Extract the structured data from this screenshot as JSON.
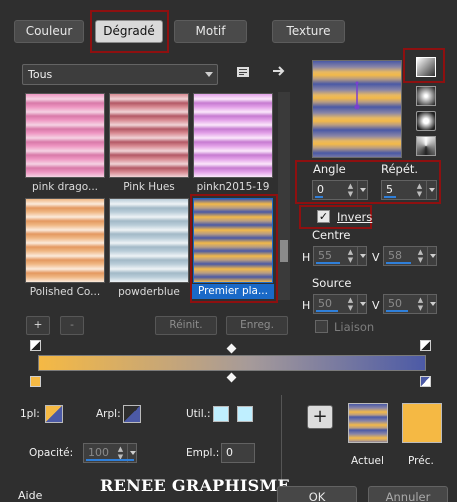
{
  "tabs": [
    {
      "label": "Couleur"
    },
    {
      "label": "Dégradé"
    },
    {
      "label": "Motif"
    },
    {
      "label": "Texture"
    }
  ],
  "category_dropdown": {
    "value": "Tous"
  },
  "gradients": [
    {
      "name": "pink drago...",
      "colors": [
        "#ee96c2",
        "#f5d2e3",
        "#d87aa9"
      ]
    },
    {
      "name": "Pink Hues",
      "colors": [
        "#d88a92",
        "#f0d3d6",
        "#b35966"
      ]
    },
    {
      "name": "pinkn2015-19",
      "colors": [
        "#e3a1e8",
        "#fbe7fb",
        "#c77bd1"
      ]
    },
    {
      "name": "Polished Co...",
      "colors": [
        "#f0b783",
        "#fbeadb",
        "#e49860"
      ]
    },
    {
      "name": "powderblue",
      "colors": [
        "#b9ccd8",
        "#eef3f6",
        "#a2b9c7"
      ]
    },
    {
      "name": "Premier pla...",
      "colors": [
        "#4a59a5",
        "#f2b94a",
        "#b79c83"
      ]
    }
  ],
  "list_buttons": {
    "add": "+",
    "remove": "-",
    "reset": "Réinit.",
    "save": "Enreg."
  },
  "angle": {
    "label": "Angle",
    "value": "0"
  },
  "repeat": {
    "label": "Répét.",
    "value": "5"
  },
  "invert": {
    "label": "Invers",
    "checked": true
  },
  "center": {
    "label": "Centre",
    "h_label": "H",
    "h_value": "55",
    "v_label": "V",
    "v_value": "58"
  },
  "source": {
    "label": "Source",
    "h_label": "H",
    "h_value": "50",
    "v_label": "V",
    "v_value": "50"
  },
  "link": {
    "label": "Liaison"
  },
  "stops": {
    "fg_label": "1pl:",
    "bg_label": "Arpl:",
    "user_label": "Util.:",
    "opacity_label": "Opacité:",
    "opacity_value": "100",
    "location_label": "Empl.:",
    "location_value": "0"
  },
  "colors": {
    "gold": "#f5b944",
    "blue": "#4c5aa6",
    "user_color": "#bfefff",
    "current_label": "Actuel",
    "previous_label": "Préc."
  },
  "footer": {
    "help": "Aide",
    "watermark": "RENEE GRAPHISME",
    "ok": "OK",
    "cancel": "Annuler"
  }
}
